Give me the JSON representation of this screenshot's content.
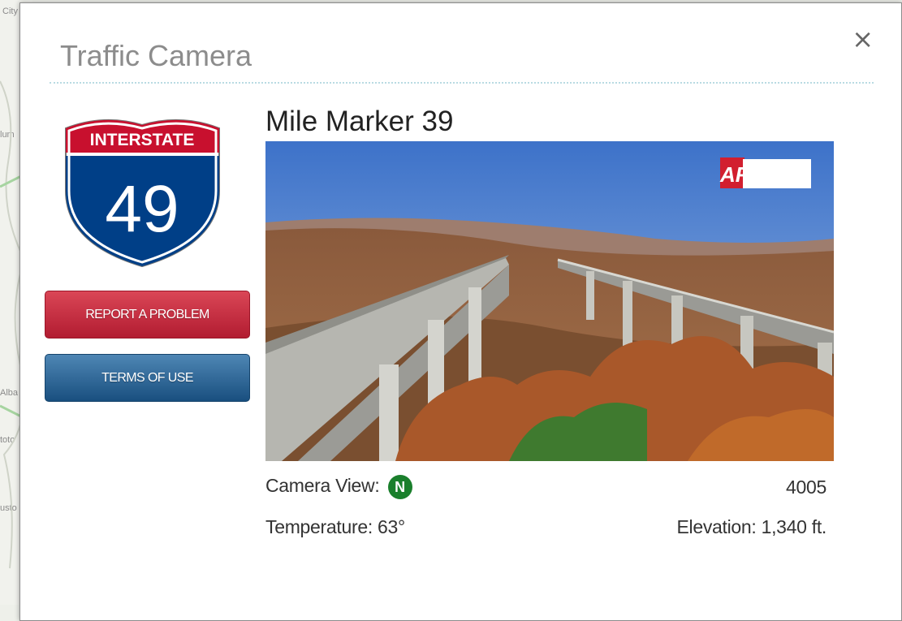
{
  "map": {
    "labels": [
      "City",
      "lum",
      "Alba",
      "toto",
      "usto"
    ]
  },
  "modal": {
    "title": "Traffic Camera",
    "close_symbol": "×"
  },
  "shield": {
    "top_text": "INTERSTATE",
    "number": "49",
    "icon": "interstate-shield-icon",
    "colors": {
      "top": "#c8102e",
      "bottom": "#003f87"
    }
  },
  "buttons": {
    "report": "REPORT A PROBLEM",
    "terms": "TERMS OF USE"
  },
  "camera": {
    "title": "Mile Marker 39",
    "logo_text": "ARDOT",
    "view_label": "Camera View:",
    "direction": "N",
    "id": "4005",
    "temperature_label": "Temperature: 63°",
    "elevation_label": "Elevation: 1,340 ft."
  }
}
